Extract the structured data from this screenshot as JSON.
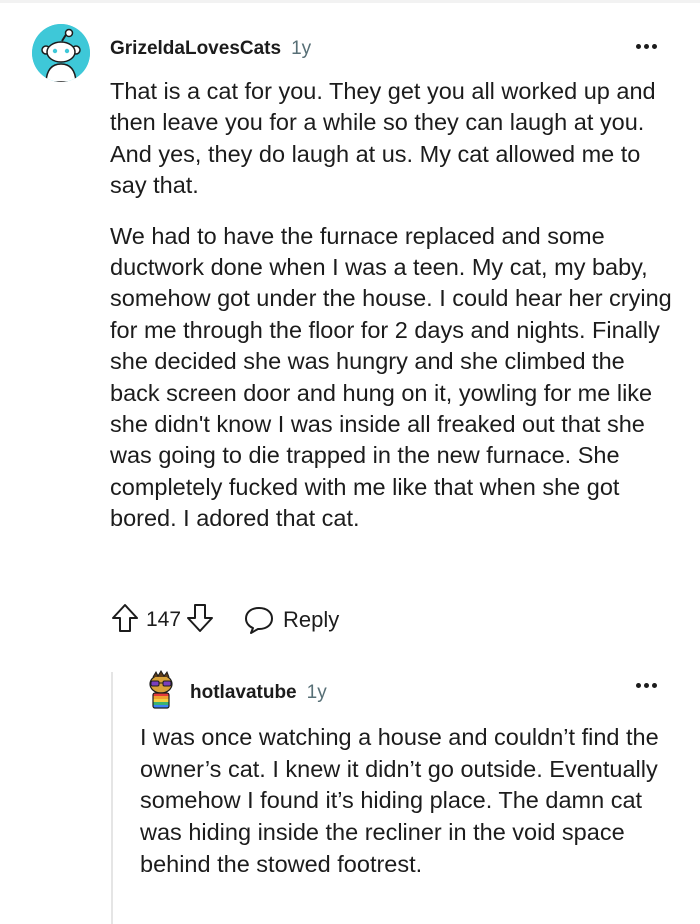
{
  "comment": {
    "username": "GrizeldaLovesCats",
    "time": "1y",
    "paragraphs": [
      "That is a cat for you. They get you all worked up and then leave you for a while so they can laugh at you. And yes, they do laugh at us. My cat allowed me to say that.",
      "We had to have the furnace replaced and some ductwork done when I was a teen. My cat, my baby, somehow got under the house. I could hear her crying for me through the floor for 2 days and nights. Finally she decided she was hungry and she climbed the back screen door and hung on it, yowling for me like she didn't know I was inside all freaked out that she was going to die trapped in the new furnace. She completely fucked with me like that when she got bored. I adored that cat."
    ],
    "vote_count": "147",
    "reply_label": "Reply",
    "avatar_color": "#3ec8d8"
  },
  "reply": {
    "username": "hotlavatube",
    "time": "1y",
    "text": "I was once watching a house and couldn’t find the owner’s cat. I knew it didn’t go outside. Eventually somehow I found it’s hiding place. The damn cat was hiding inside the recliner in the void space behind the stowed footrest."
  },
  "icons": {
    "upvote": "arrow-up-icon",
    "downvote": "arrow-down-icon",
    "reply": "speech-bubble-icon",
    "more": "more-horizontal-icon"
  }
}
